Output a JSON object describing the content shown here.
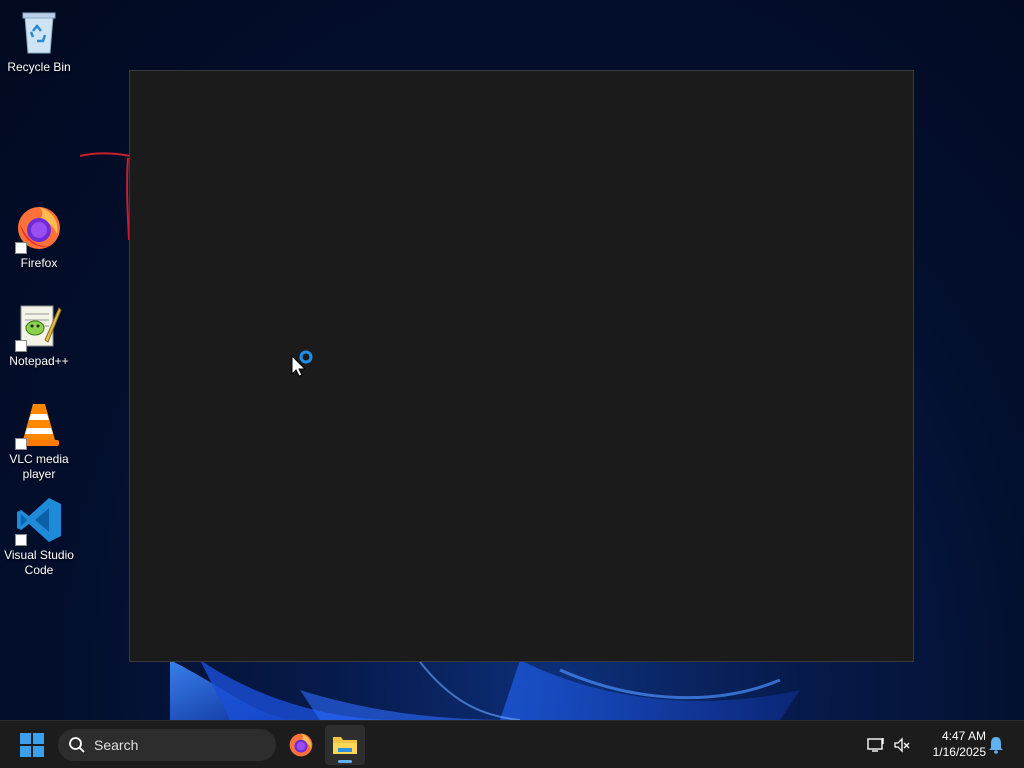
{
  "desktop": {
    "icons": [
      {
        "label": "Recycle Bin",
        "icon": "recycle-bin-icon"
      },
      {
        "label": "Firefox",
        "icon": "firefox-icon"
      },
      {
        "label": "Notepad++",
        "icon": "notepad-plus-plus-icon"
      },
      {
        "label": "VLC media player",
        "icon": "vlc-icon"
      },
      {
        "label": "Visual Studio Code",
        "icon": "vscode-icon"
      }
    ]
  },
  "window": {
    "state": "loading",
    "background": "#1b1b1b"
  },
  "taskbar": {
    "search_label": "Search",
    "pinned": [
      {
        "name": "firefox",
        "icon": "firefox-icon",
        "active": false
      },
      {
        "name": "file-explorer",
        "icon": "folder-icon",
        "active": true
      }
    ],
    "clock": {
      "time": "4:47 AM",
      "date": "1/16/2025"
    }
  },
  "colors": {
    "accent": "#5fb2f2",
    "taskbar_bg": "#1c1c1c",
    "annotation": "#c8202a"
  }
}
